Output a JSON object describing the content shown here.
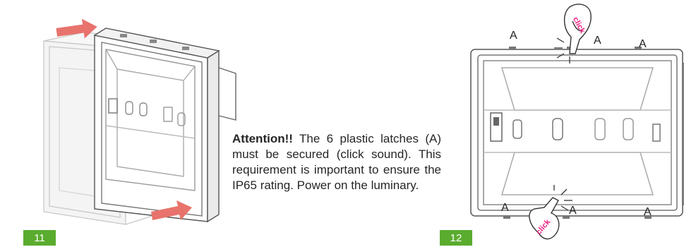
{
  "colors": {
    "badge": "#5aac2f",
    "arrow": "#e8736d",
    "click": "#e6197d",
    "line": "#4a4a4a"
  },
  "steps": [
    {
      "number": "11"
    },
    {
      "number": "12"
    }
  ],
  "note": {
    "emphasis": "Attention!!",
    "body": "The 6 plastic latches (A) must be secured (click sound). This requirement is important to ensure the IP65 rating. Power on the luminary."
  },
  "latch_label": "A",
  "click_label": "click",
  "icons": [
    "arrow-right-icon",
    "hand-pointer-icon",
    "click-burst-icon"
  ]
}
